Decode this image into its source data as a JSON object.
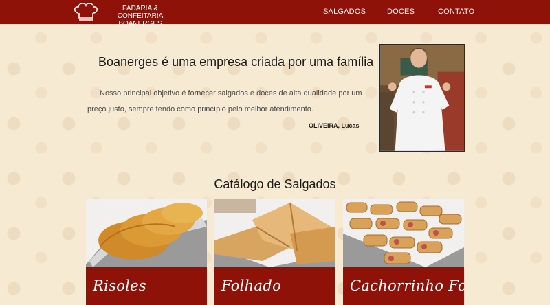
{
  "header": {
    "brand_line1": "PADARIA & CONFEITARIA",
    "brand_line2": "BOANERGES",
    "logo_icon": "chef-hat-icon",
    "nav": {
      "salgados": "SALGADOS",
      "doces": "DOCES",
      "contato": "CONTATO"
    }
  },
  "intro": {
    "title": "Boanerges é uma empresa criada por uma família",
    "text": "Nosso principal objetivo é fornecer salgados e doces de alta qualidade por um preço justo, sempre tendo como princípio pelo melhor atendimento.",
    "author": "OLIVEIRA, Lucas"
  },
  "catalog": {
    "title": "Catálogo de Salgados",
    "items": [
      {
        "label": "Risoles"
      },
      {
        "label": "Folhado"
      },
      {
        "label": "Cachorrinho Folhado"
      }
    ]
  },
  "colors": {
    "brand_red": "#8f1209",
    "background": "#f7ead2"
  }
}
